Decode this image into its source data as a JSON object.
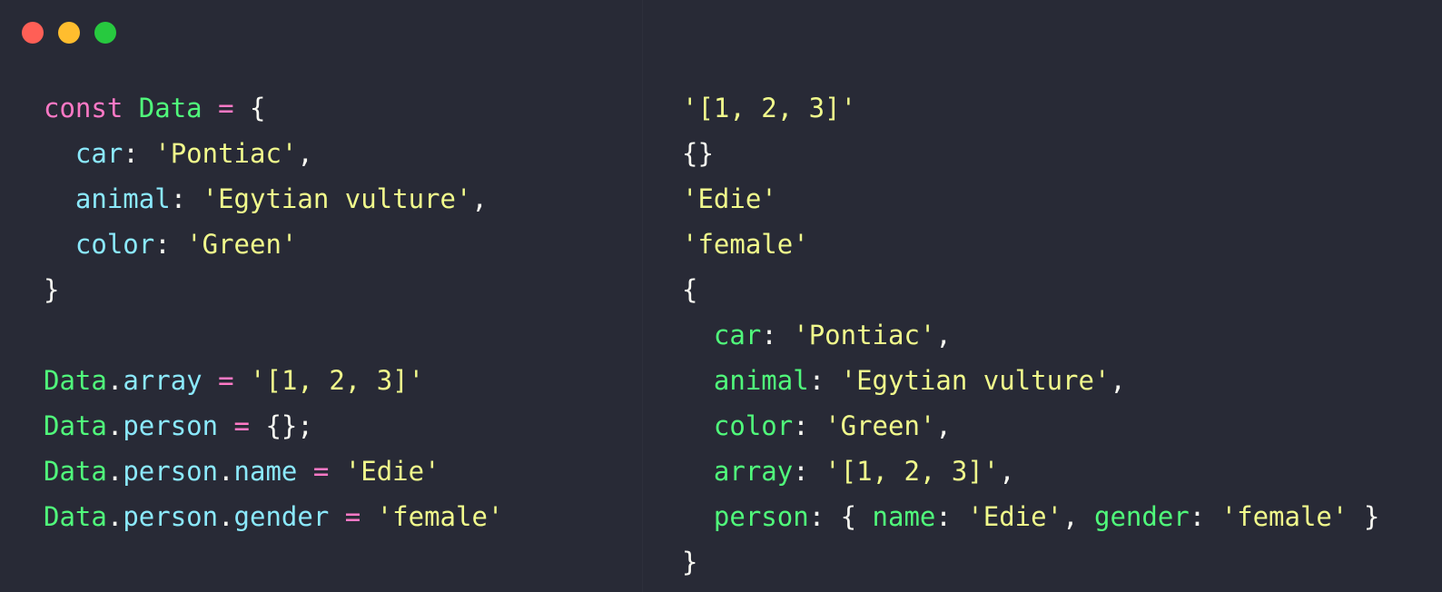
{
  "window_controls": {
    "close_color": "#ff5f56",
    "minimize_color": "#ffbd2e",
    "maximize_color": "#27c93f"
  },
  "theme": {
    "background": "#282a36",
    "keyword": "#ff79c6",
    "variable": "#50fa7b",
    "property": "#8be9fd",
    "string": "#f1fa8c",
    "punctuation": "#f8f8f2"
  },
  "editor": {
    "lines": [
      [
        {
          "t": "const",
          "k": "kw"
        },
        {
          "t": " ",
          "k": "pun"
        },
        {
          "t": "Data",
          "k": "var"
        },
        {
          "t": " ",
          "k": "pun"
        },
        {
          "t": "=",
          "k": "op"
        },
        {
          "t": " {",
          "k": "pun"
        }
      ],
      [
        {
          "t": "  ",
          "k": "pun"
        },
        {
          "t": "car",
          "k": "prop"
        },
        {
          "t": ": ",
          "k": "pun"
        },
        {
          "t": "'Pontiac'",
          "k": "str"
        },
        {
          "t": ",",
          "k": "pun"
        }
      ],
      [
        {
          "t": "  ",
          "k": "pun"
        },
        {
          "t": "animal",
          "k": "prop"
        },
        {
          "t": ": ",
          "k": "pun"
        },
        {
          "t": "'Egytian vulture'",
          "k": "str"
        },
        {
          "t": ",",
          "k": "pun"
        }
      ],
      [
        {
          "t": "  ",
          "k": "pun"
        },
        {
          "t": "color",
          "k": "prop"
        },
        {
          "t": ": ",
          "k": "pun"
        },
        {
          "t": "'Green'",
          "k": "str"
        }
      ],
      [
        {
          "t": "}",
          "k": "pun"
        }
      ],
      [],
      [
        {
          "t": "Data",
          "k": "var"
        },
        {
          "t": ".",
          "k": "pun"
        },
        {
          "t": "array",
          "k": "prop"
        },
        {
          "t": " ",
          "k": "pun"
        },
        {
          "t": "=",
          "k": "op"
        },
        {
          "t": " ",
          "k": "pun"
        },
        {
          "t": "'[1, 2, 3]'",
          "k": "str"
        }
      ],
      [
        {
          "t": "Data",
          "k": "var"
        },
        {
          "t": ".",
          "k": "pun"
        },
        {
          "t": "person",
          "k": "prop"
        },
        {
          "t": " ",
          "k": "pun"
        },
        {
          "t": "=",
          "k": "op"
        },
        {
          "t": " {};",
          "k": "pun"
        }
      ],
      [
        {
          "t": "Data",
          "k": "var"
        },
        {
          "t": ".",
          "k": "pun"
        },
        {
          "t": "person",
          "k": "prop"
        },
        {
          "t": ".",
          "k": "pun"
        },
        {
          "t": "name",
          "k": "prop"
        },
        {
          "t": " ",
          "k": "pun"
        },
        {
          "t": "=",
          "k": "op"
        },
        {
          "t": " ",
          "k": "pun"
        },
        {
          "t": "'Edie'",
          "k": "str"
        }
      ],
      [
        {
          "t": "Data",
          "k": "var"
        },
        {
          "t": ".",
          "k": "pun"
        },
        {
          "t": "person",
          "k": "prop"
        },
        {
          "t": ".",
          "k": "pun"
        },
        {
          "t": "gender",
          "k": "prop"
        },
        {
          "t": " ",
          "k": "pun"
        },
        {
          "t": "=",
          "k": "op"
        },
        {
          "t": " ",
          "k": "pun"
        },
        {
          "t": "'female'",
          "k": "str"
        }
      ]
    ]
  },
  "output": {
    "lines": [
      [
        {
          "t": "'[1, 2, 3]'",
          "k": "str"
        }
      ],
      [
        {
          "t": "{}",
          "k": "pun"
        }
      ],
      [
        {
          "t": "'Edie'",
          "k": "str"
        }
      ],
      [
        {
          "t": "'female'",
          "k": "str"
        }
      ],
      [
        {
          "t": "{",
          "k": "pun"
        }
      ],
      [
        {
          "t": "  ",
          "k": "pun"
        },
        {
          "t": "car",
          "k": "prop-out"
        },
        {
          "t": ": ",
          "k": "pun"
        },
        {
          "t": "'Pontiac'",
          "k": "str"
        },
        {
          "t": ",",
          "k": "pun"
        }
      ],
      [
        {
          "t": "  ",
          "k": "pun"
        },
        {
          "t": "animal",
          "k": "prop-out"
        },
        {
          "t": ": ",
          "k": "pun"
        },
        {
          "t": "'Egytian vulture'",
          "k": "str"
        },
        {
          "t": ",",
          "k": "pun"
        }
      ],
      [
        {
          "t": "  ",
          "k": "pun"
        },
        {
          "t": "color",
          "k": "prop-out"
        },
        {
          "t": ": ",
          "k": "pun"
        },
        {
          "t": "'Green'",
          "k": "str"
        },
        {
          "t": ",",
          "k": "pun"
        }
      ],
      [
        {
          "t": "  ",
          "k": "pun"
        },
        {
          "t": "array",
          "k": "prop-out"
        },
        {
          "t": ": ",
          "k": "pun"
        },
        {
          "t": "'[1, 2, 3]'",
          "k": "str"
        },
        {
          "t": ",",
          "k": "pun"
        }
      ],
      [
        {
          "t": "  ",
          "k": "pun"
        },
        {
          "t": "person",
          "k": "prop-out"
        },
        {
          "t": ": { ",
          "k": "pun"
        },
        {
          "t": "name",
          "k": "prop-out"
        },
        {
          "t": ": ",
          "k": "pun"
        },
        {
          "t": "'Edie'",
          "k": "str"
        },
        {
          "t": ", ",
          "k": "pun"
        },
        {
          "t": "gender",
          "k": "prop-out"
        },
        {
          "t": ": ",
          "k": "pun"
        },
        {
          "t": "'female'",
          "k": "str"
        },
        {
          "t": " }",
          "k": "pun"
        }
      ],
      [
        {
          "t": "}",
          "k": "pun"
        }
      ]
    ]
  }
}
